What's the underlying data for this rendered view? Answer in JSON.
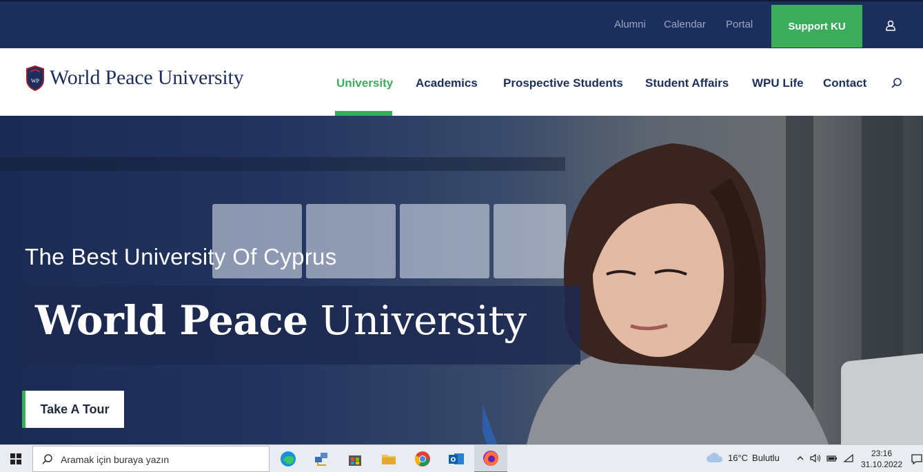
{
  "topbar": {
    "links": [
      "Alumni",
      "Calendar",
      "Portal"
    ],
    "support_label": "Support KU",
    "user_icon": "user-icon",
    "bg_color": "#1c2e5c",
    "accent_color": "#3bab5c"
  },
  "nav": {
    "logo_text": "World Peace University",
    "items": [
      {
        "label": "University",
        "active": true
      },
      {
        "label": "Academics",
        "active": false
      },
      {
        "label": "Prospective Students",
        "active": false
      },
      {
        "label": "Student Affairs",
        "active": false
      },
      {
        "label": "WPU Life",
        "active": false
      },
      {
        "label": "Contact",
        "active": false
      }
    ],
    "search_icon": "search-icon"
  },
  "hero": {
    "subtitle": "The Best University Of Cyprus",
    "title_bold": "World Peace",
    "title_light": "University",
    "cta_label": "Take A Tour"
  },
  "taskbar": {
    "search_placeholder": "Aramak için buraya yazın",
    "apps": [
      "edge-icon",
      "network-app-icon",
      "store-icon",
      "file-explorer-icon",
      "chrome-icon",
      "outlook-icon",
      "firefox-icon"
    ],
    "active_app": "firefox-icon",
    "weather_temp": "16°C",
    "weather_text": "Bulutlu",
    "time": "23:16",
    "date": "31.10.2022"
  }
}
